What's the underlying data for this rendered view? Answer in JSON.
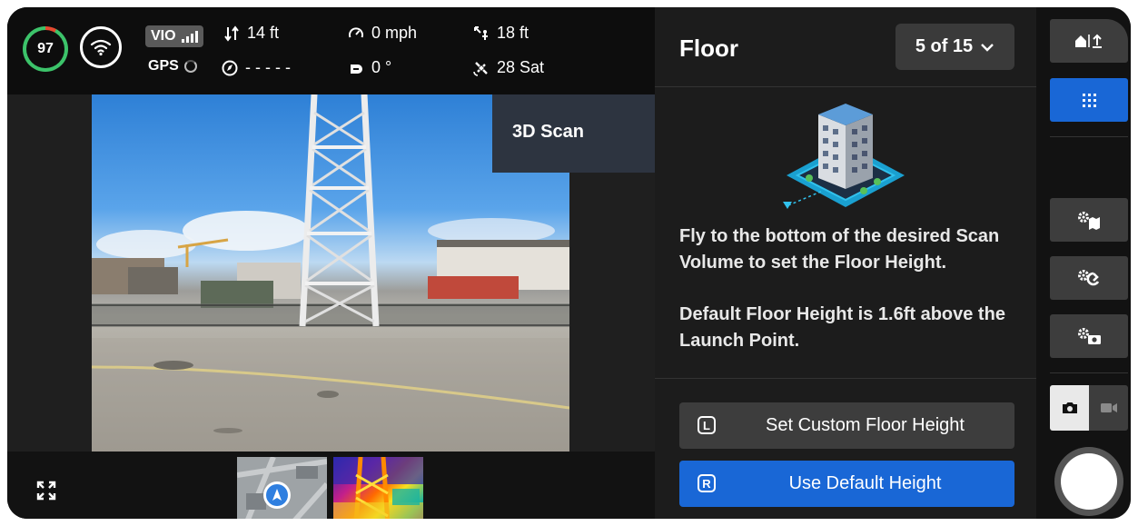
{
  "status": {
    "battery": "97",
    "vio_label": "VIO",
    "gps_label": "GPS",
    "altitude": "14 ft",
    "heading": "- - - - -",
    "speed": "0 mph",
    "gimbal": "0 °",
    "distance": "18 ft",
    "satellites": "28 Sat"
  },
  "video": {
    "mode_label": "3D Scan"
  },
  "panel": {
    "title": "Floor",
    "step_counter": "5 of 15",
    "description_1": "Fly to the bottom of the desired Scan Volume to set the Floor Height.",
    "description_2": "Default Floor Height is 1.6ft above the Launch Point.",
    "custom_button": {
      "key": "L",
      "label": "Set Custom Floor Height"
    },
    "default_button": {
      "key": "R",
      "label": "Use Default Height"
    }
  },
  "colors": {
    "accent_blue": "#1967d6",
    "battery_green": "#3cc36a",
    "battery_red": "#e4492f"
  },
  "icons": [
    "wifi-icon",
    "altitude-icon",
    "compass-icon",
    "speedometer-icon",
    "gimbal-icon",
    "distance-icon",
    "satellite-icon",
    "expand-icon",
    "home-icon",
    "grid-icon",
    "camera-icon",
    "video-icon"
  ]
}
